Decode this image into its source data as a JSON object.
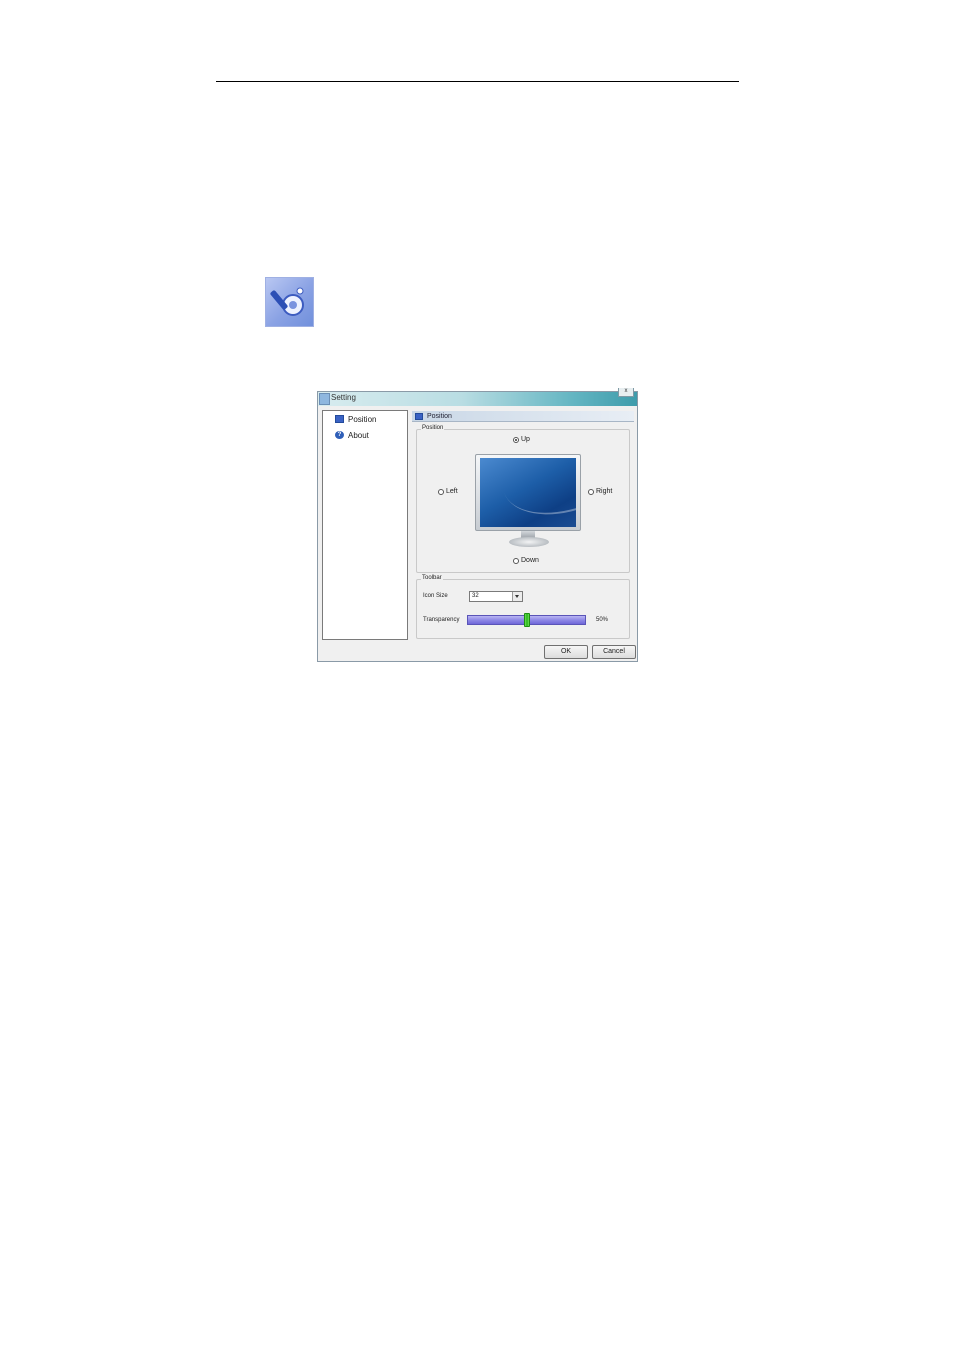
{
  "dialog": {
    "title": "Setting",
    "close_label": "x",
    "ok_label": "OK",
    "cancel_label": "Cancel"
  },
  "nav": {
    "items": [
      {
        "label": "Position",
        "icon": "monitor-icon"
      },
      {
        "label": "About",
        "icon": "help-icon"
      }
    ],
    "selected": "Position"
  },
  "content": {
    "header": "Position",
    "position_group": {
      "label": "Position",
      "options": {
        "up": "Up",
        "left": "Left",
        "right": "Right",
        "down": "Down"
      },
      "selected": "Up"
    },
    "toolbar_group": {
      "label": "Toolbar",
      "icon_size_label": "Icon Size",
      "icon_size_value": "32",
      "transparency_label": "Transparency",
      "transparency_value_text": "50%",
      "transparency_fraction": 0.5
    }
  },
  "colors": {
    "slider": "#8f89e6",
    "slider_thumb": "#28b419",
    "screen": "#1d5ea8"
  }
}
